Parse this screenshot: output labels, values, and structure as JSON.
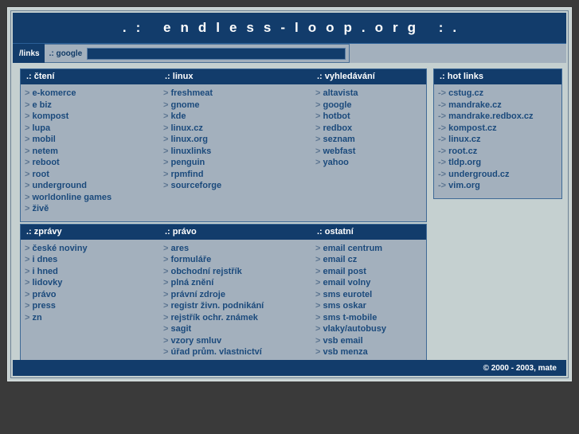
{
  "site": {
    "title": ".: endless-loop.org :.",
    "footer": "© 2000 - 2003, mate",
    "accent_dark": "#123c6b",
    "panel_bg": "#a3b0bd",
    "page_bg": "#c5d0d0",
    "link_color": "#1b4a7c"
  },
  "search": {
    "links_label": "/links",
    "engine_label": ".: google",
    "value": "",
    "placeholder": ""
  },
  "sections": [
    {
      "id": "cteni",
      "header": ".: čtení",
      "items": [
        "e-komerce",
        "e biz",
        "kompost",
        "lupa",
        "mobil",
        "netem",
        "reboot",
        "root",
        "underground",
        "worldonline games",
        "živě"
      ]
    },
    {
      "id": "linux",
      "header": ".: linux",
      "items": [
        "freshmeat",
        "gnome",
        "kde",
        "linux.cz",
        "linux.org",
        "linuxlinks",
        "penguin",
        "rpmfind",
        "sourceforge"
      ]
    },
    {
      "id": "vyhledavani",
      "header": ".: vyhledávání",
      "items": [
        "altavista",
        "google",
        "hotbot",
        "redbox",
        "seznam",
        "webfast",
        "yahoo"
      ]
    },
    {
      "id": "zpravy",
      "header": ".: zprávy",
      "items": [
        "české noviny",
        "i dnes",
        "i hned",
        "lidovky",
        "právo",
        "press",
        "zn"
      ]
    },
    {
      "id": "pravo",
      "header": ".: právo",
      "items": [
        "ares",
        "formuláře",
        "obchodní rejstřík",
        "plná znění",
        "právní zdroje",
        "registr živn. podnikání",
        "rejstřík ochr. známek",
        "sagit",
        "vzory smluv",
        "úřad prům. vlastnictví"
      ]
    },
    {
      "id": "ostatni",
      "header": ".: ostatní",
      "items": [
        "email centrum",
        "email cz",
        "email post",
        "email volny",
        "sms eurotel",
        "sms oskar",
        "sms t-mobile",
        "vlaky/autobusy",
        "vsb email",
        "vsb menza"
      ]
    }
  ],
  "hot_links": {
    "header": ".: hot links",
    "items": [
      "cstug.cz",
      "mandrake.cz",
      "mandrake.redbox.cz",
      "kompost.cz",
      "linux.cz",
      "root.cz",
      "tldp.org",
      "undergroud.cz",
      "vim.org"
    ]
  },
  "bullets": {
    "column": ">",
    "hot": "->"
  }
}
